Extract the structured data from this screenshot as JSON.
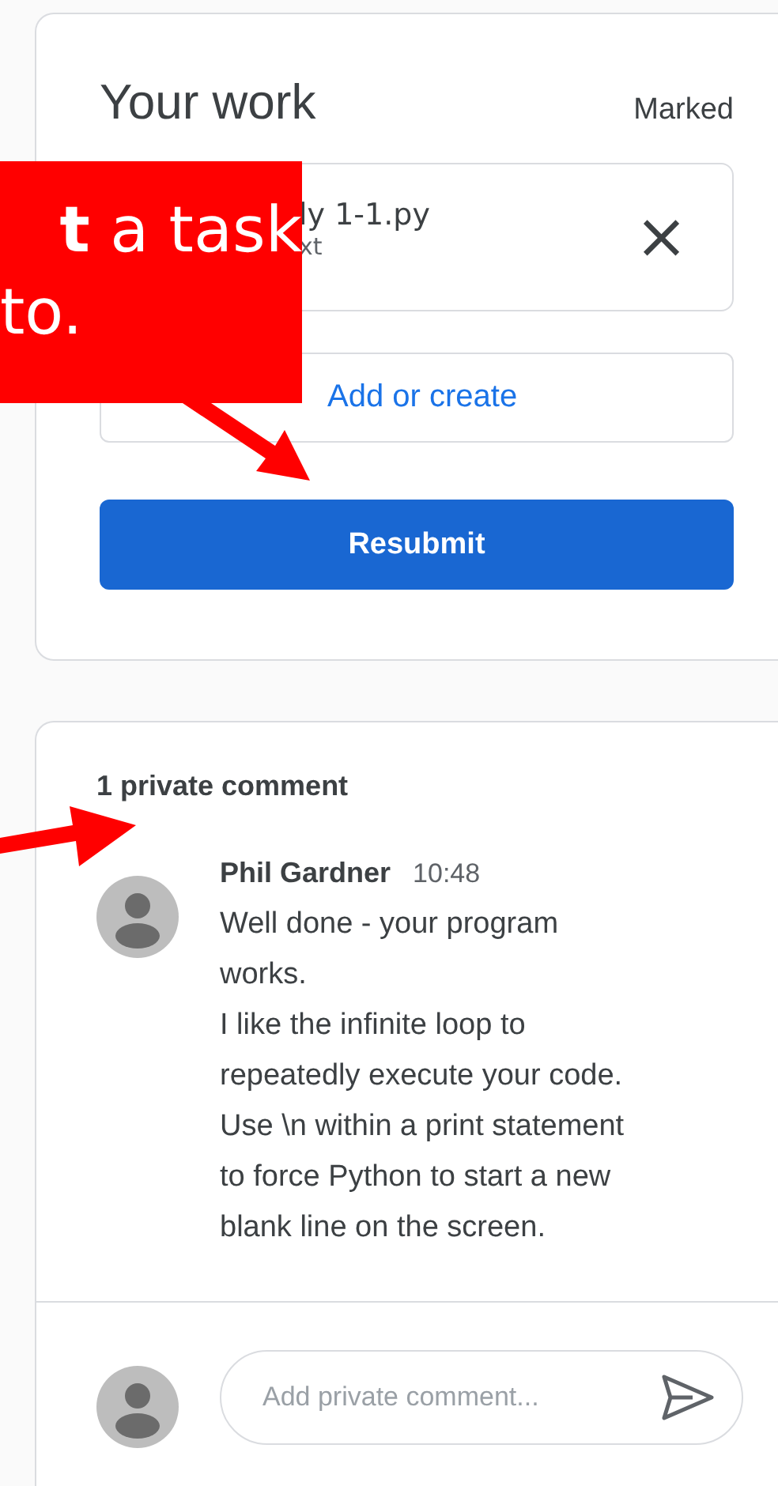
{
  "your_work": {
    "title": "Your work",
    "status": "Marked",
    "attachment": {
      "name": "ly 1-1.py",
      "subtitle": "xt",
      "remove_icon": "×"
    },
    "add_button": "Add or create",
    "resubmit_button": "Resubmit"
  },
  "comments": {
    "heading": "1 private comment",
    "items": [
      {
        "author": "Phil Gardner",
        "time": "10:48",
        "lines": [
          "Well done - your program",
          "works.",
          "I like the infinite loop to",
          "repeatedly execute your code.",
          "Use \\n within a print statement",
          "to force Python to start a new",
          "blank line on the screen."
        ]
      }
    ],
    "input": {
      "placeholder": "Add private comment..."
    }
  },
  "callout": {
    "lines": [
      "**t** a task",
      "to."
    ]
  }
}
